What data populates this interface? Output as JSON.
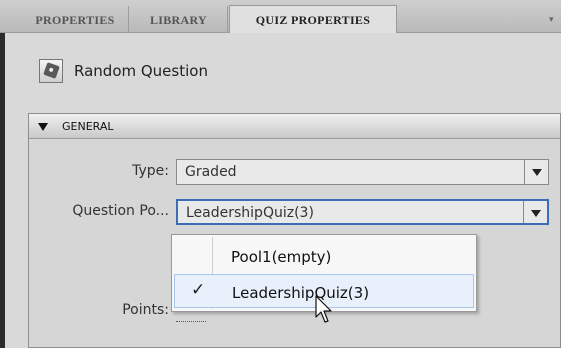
{
  "tabs": [
    {
      "label": "PROPERTIES",
      "active": false
    },
    {
      "label": "LIBRARY",
      "active": false
    },
    {
      "label": "QUIZ PROPERTIES",
      "active": true
    }
  ],
  "item": {
    "icon": "dice-icon",
    "title": "Random Question"
  },
  "section": {
    "title": "GENERAL",
    "icon": "collapse-triangle-icon"
  },
  "fields": {
    "type_label": "Type:",
    "type_value": "Graded",
    "pool_label": "Question Po...",
    "pool_value": "LeadershipQuiz(3)",
    "points_label": "Points:"
  },
  "dropdown": {
    "options": [
      {
        "label": "Pool1(empty)",
        "checked": false
      },
      {
        "label": "LeadershipQuiz(3)",
        "checked": true
      }
    ],
    "check_glyph": "✓"
  },
  "colors": {
    "focus_border": "#3b6fb5",
    "hover_highlight": "#e8f1fb"
  }
}
